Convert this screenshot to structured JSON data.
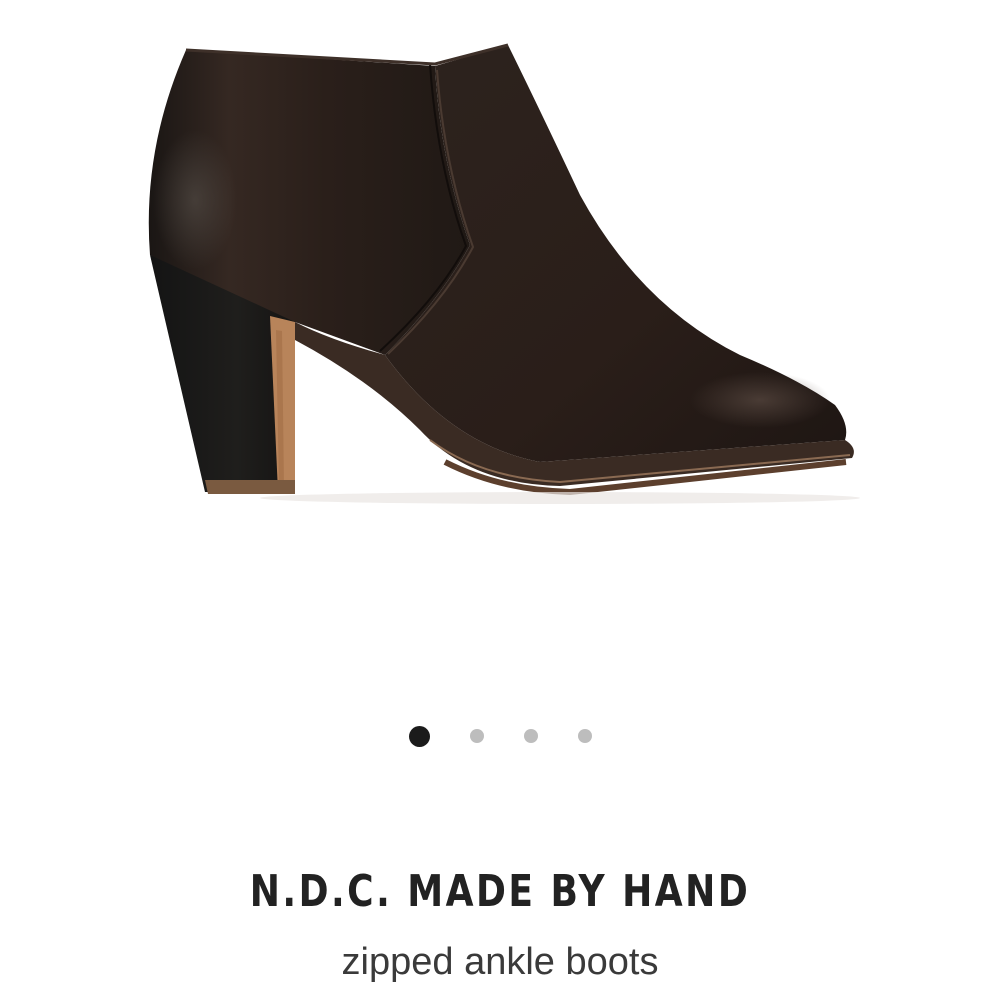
{
  "product": {
    "image_alt": "dark brown leather zipped ankle boot with stacked block heel",
    "brand": "N.D.C. MADE BY HAND",
    "name": "zipped ankle boots"
  },
  "gallery": {
    "image_count": 4,
    "active_index": 0
  },
  "colors": {
    "active_dot": "#1b1b1b",
    "inactive_dot": "#bdbdbd",
    "leather": "#2c211c",
    "heel_wood": "#b8845a"
  }
}
